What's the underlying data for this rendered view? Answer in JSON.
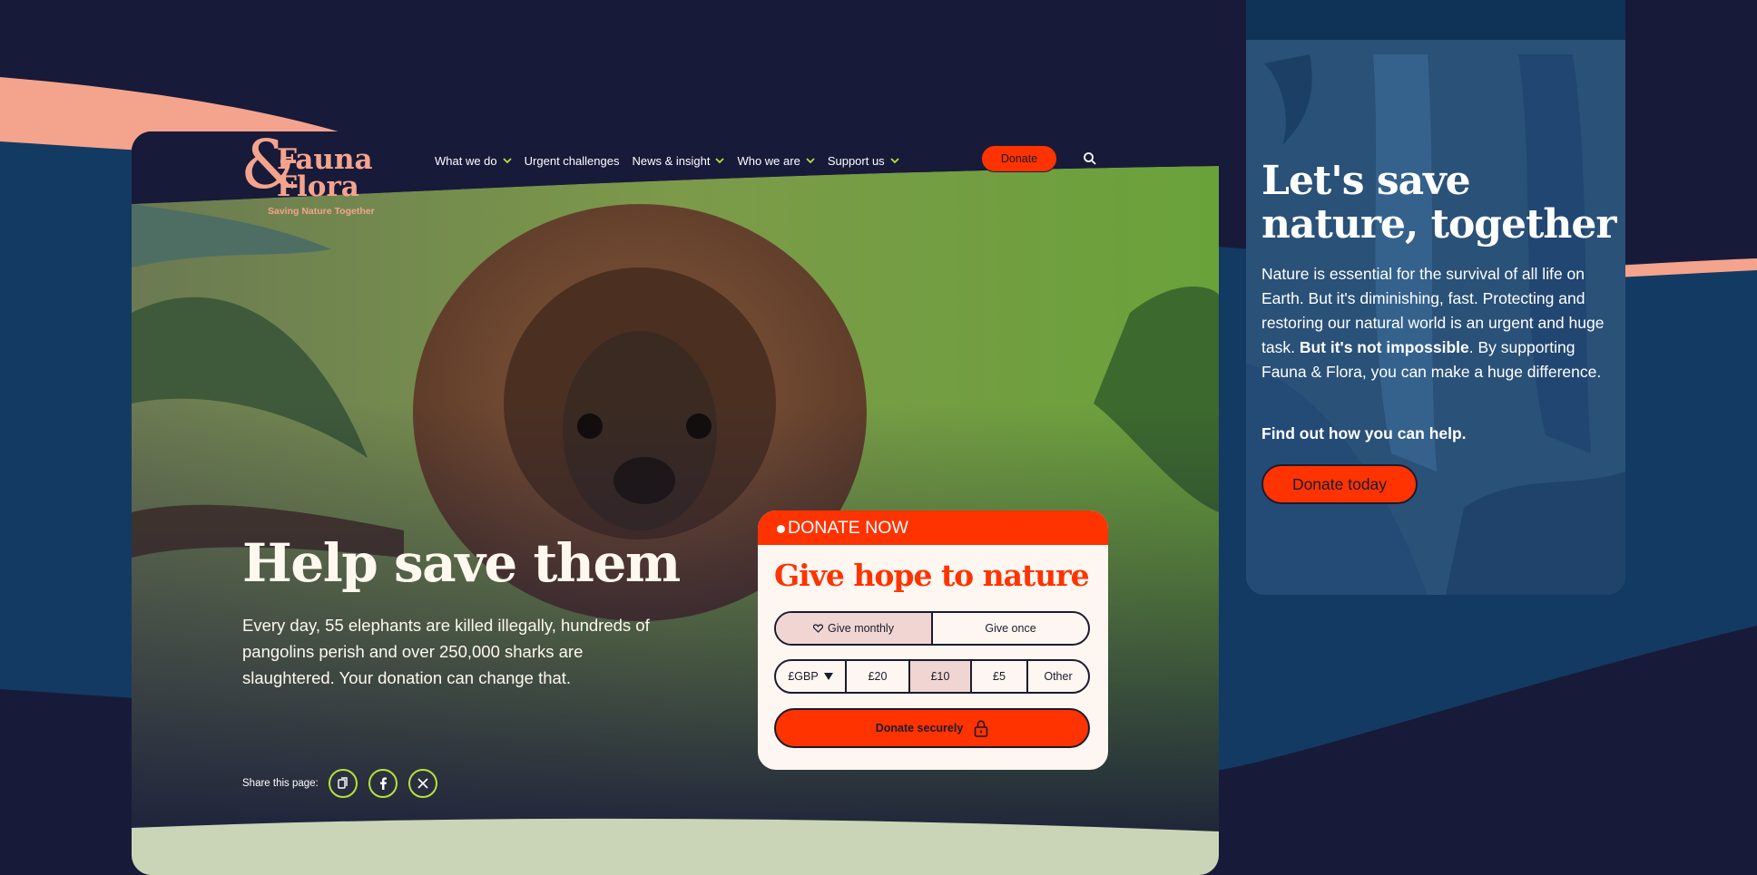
{
  "colors": {
    "background": "#181a3a",
    "accent_orange": "#ff3300",
    "brand_peach": "#f4a48c",
    "share_green": "#b6e23c",
    "widget_cream": "#fef6f0",
    "selected_pink": "#f0d5d2",
    "panel_blue": "#254a72"
  },
  "logo": {
    "ampersand": "&",
    "word1": "Fauna",
    "word2": "Flora",
    "tagline": "Saving Nature Together"
  },
  "nav": {
    "items": [
      {
        "label": "What we do",
        "dropdown": true
      },
      {
        "label": "Urgent challenges",
        "dropdown": false
      },
      {
        "label": "News & insight",
        "dropdown": true
      },
      {
        "label": "Who we are",
        "dropdown": true
      },
      {
        "label": "Support us",
        "dropdown": true
      }
    ],
    "donate_label": "Donate",
    "search_icon": "search-icon"
  },
  "hero": {
    "title": "Help save them",
    "text": "Every day, 55 elephants are killed illegally, hundreds of pangolins perish and over 250,000 sharks are slaughtered. Your donation can change that."
  },
  "share": {
    "label": "Share this page:",
    "icons": [
      "copy-link-icon",
      "facebook-icon",
      "x-icon"
    ]
  },
  "widget": {
    "header": "DONATE NOW",
    "title": "Give hope to nature",
    "frequency": {
      "monthly": "Give monthly",
      "once": "Give once",
      "selected": "monthly"
    },
    "currency": "£GBP",
    "amounts": [
      "£20",
      "£10",
      "£5"
    ],
    "selected_amount": "£10",
    "other": "Other",
    "submit_label": "Donate securely"
  },
  "side": {
    "title": "Let's save nature, together",
    "text_1": "Nature is essential for the survival of all life on Earth. But it's diminishing, fast. Protecting and restoring our natural world is an urgent and huge task. ",
    "text_bold": "But it's not impossible",
    "text_2": ". By supporting Fauna & Flora, you can make a huge difference.",
    "cta": "Find out how you can help.",
    "button_label": "Donate today"
  }
}
